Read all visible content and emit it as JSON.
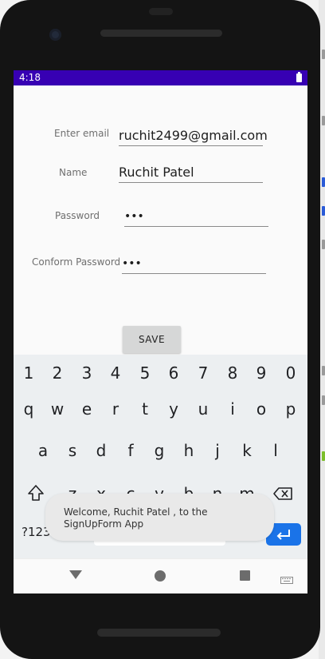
{
  "status_bar": {
    "time": "4:18"
  },
  "form": {
    "email": {
      "label": "Enter email",
      "value": "ruchit2499@gmail.com"
    },
    "name": {
      "label": "Name",
      "value": "Ruchit Patel"
    },
    "password": {
      "label": "Password",
      "value": "•••"
    },
    "confirm_password": {
      "label": "Conform Password",
      "value": "•••"
    },
    "save_label": "SAVE"
  },
  "keyboard": {
    "row_numbers": [
      "1",
      "2",
      "3",
      "4",
      "5",
      "6",
      "7",
      "8",
      "9",
      "0"
    ],
    "row_top": [
      "q",
      "w",
      "e",
      "r",
      "t",
      "y",
      "u",
      "i",
      "o",
      "p"
    ],
    "row_middle": [
      "a",
      "s",
      "d",
      "f",
      "g",
      "h",
      "j",
      "k",
      "l"
    ],
    "row_bottom": [
      "z",
      "x",
      "c",
      "v",
      "b",
      "n",
      "m"
    ],
    "symbols_label": "?123",
    "comma_label": ",",
    "period_label": "."
  },
  "toast": {
    "message": "Welcome, Ruchit Patel , to the SignUpForm App"
  },
  "colors": {
    "status_bar": "#3700b3",
    "enter_key": "#1a73e8"
  },
  "icons": [
    "battery-icon",
    "shift-icon",
    "backspace-icon",
    "enter-icon",
    "back-icon",
    "home-icon",
    "recents-icon",
    "keyboard-switch-icon"
  ]
}
